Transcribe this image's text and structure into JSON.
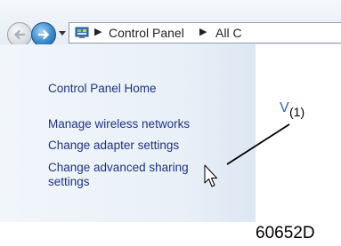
{
  "breadcrumb": {
    "items": [
      "Control Panel",
      "All C"
    ]
  },
  "navigation": {
    "links": [
      "Control Panel Home",
      "Manage wireless networks",
      "Change adapter settings",
      "Change advanced sharing",
      "settings"
    ]
  },
  "content": {
    "partial_glyph": "V"
  },
  "annotations": {
    "callout": "(1)",
    "reference_code": "60652D"
  },
  "icons": [
    "back-arrow-icon",
    "forward-arrow-icon",
    "recent-pages-icon",
    "control-panel-icon",
    "breadcrumb-separator-icon",
    "mouse-cursor-icon"
  ],
  "colors": {
    "link_text": "#1e3287",
    "forward_button": "#3b89cc",
    "nav_pane": "#e9f0f8"
  }
}
